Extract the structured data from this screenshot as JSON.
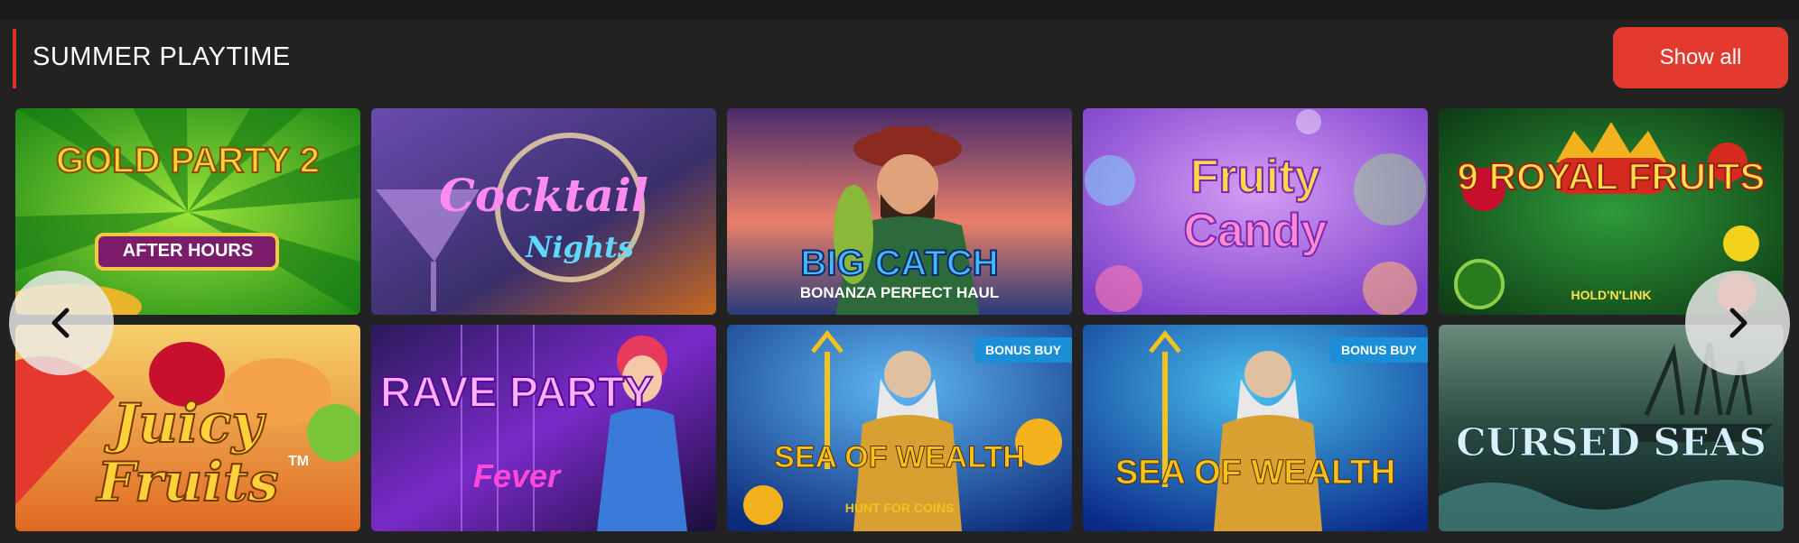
{
  "section": {
    "title": "SUMMER PLAYTIME",
    "show_all_label": "Show all",
    "accent_color": "#e0342b"
  },
  "games": [
    {
      "id": "gold-party-2",
      "title": "GOLD PARTY 2",
      "subtitle": "AFTER HOURS"
    },
    {
      "id": "cocktail-nights",
      "title": "Cocktail",
      "subtitle": "Nights"
    },
    {
      "id": "big-catch",
      "title": "BIG CATCH",
      "subtitle": "BONANZA PERFECT HAUL"
    },
    {
      "id": "fruity-candy",
      "title": "Fruity",
      "subtitle": "Candy"
    },
    {
      "id": "royal-fruits",
      "title": "9 ROYAL FRUITS",
      "subtitle": "HOLD'N'LINK"
    },
    {
      "id": "juicy-fruits",
      "title": "Juicy",
      "subtitle": "Fruits",
      "tm": "TM"
    },
    {
      "id": "rave-party",
      "title": "RAVE PARTY",
      "subtitle": "Fever"
    },
    {
      "id": "sea-of-wealth-hunt",
      "title": "SEA OF WEALTH",
      "subtitle": "HUNT FOR COINS",
      "badge": "BONUS BUY"
    },
    {
      "id": "sea-of-wealth",
      "title": "SEA OF WEALTH",
      "badge": "BONUS BUY"
    },
    {
      "id": "cursed-seas",
      "title": "CURSED SEAS"
    }
  ],
  "icons": {
    "prev": "chevron-left-icon",
    "next": "chevron-right-icon"
  }
}
